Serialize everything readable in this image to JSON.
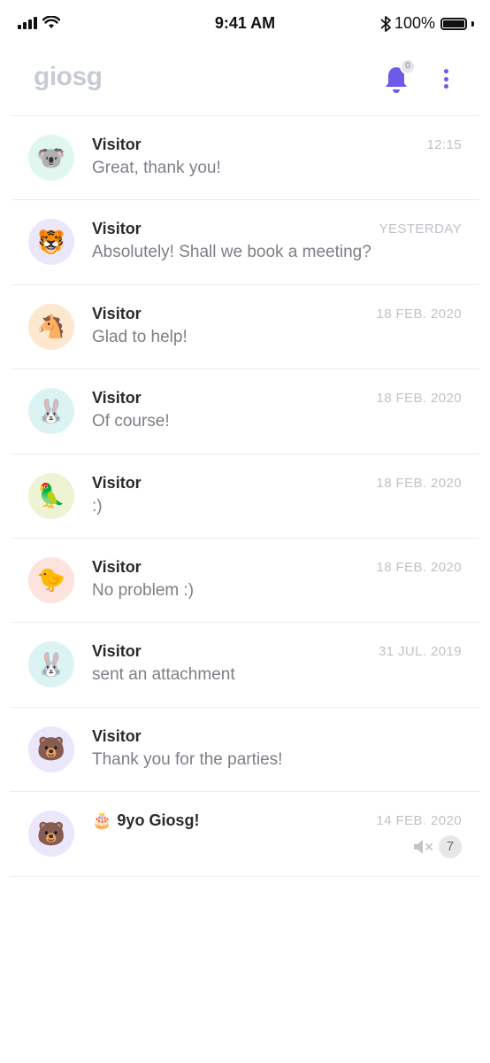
{
  "status_bar": {
    "time": "9:41 AM",
    "battery_text": "100%",
    "battery_level": 1.0
  },
  "header": {
    "logo": "giosg",
    "notification_badge": "0",
    "accent_color": "#6b5be6"
  },
  "conversations": [
    {
      "name": "Visitor",
      "preview": "Great, thank you!",
      "time": "12:15",
      "avatar_emoji": "🐨",
      "avatar_bg": "#dff7ee"
    },
    {
      "name": "Visitor",
      "preview": "Absolutely! Shall we book a meeting?",
      "time": "YESTERDAY",
      "avatar_emoji": "🐯",
      "avatar_bg": "#ece6fb"
    },
    {
      "name": "Visitor",
      "preview": "Glad to help!",
      "time": "18 FEB. 2020",
      "avatar_emoji": "🐴",
      "avatar_bg": "#fde8cf"
    },
    {
      "name": "Visitor",
      "preview": "Of course!",
      "time": "18 FEB. 2020",
      "avatar_emoji": "🐰",
      "avatar_bg": "#dcf3f4"
    },
    {
      "name": "Visitor",
      "preview": ":)",
      "time": "18 FEB. 2020",
      "avatar_emoji": "🦜",
      "avatar_bg": "#eef3d4"
    },
    {
      "name": "Visitor",
      "preview": "No problem :)",
      "time": "18 FEB. 2020",
      "avatar_emoji": "🐤",
      "avatar_bg": "#fde2de"
    },
    {
      "name": "Visitor",
      "preview": "sent an attachment",
      "time": "31 JUL. 2019",
      "avatar_emoji": "🐰",
      "avatar_bg": "#dcf3f4"
    },
    {
      "name": "Visitor",
      "preview": "Thank you for the parties!",
      "time": "",
      "avatar_emoji": "🐻",
      "avatar_bg": "#ece6fb"
    },
    {
      "name": "9yo Giosg!",
      "name_emoji": "🎂",
      "preview": "",
      "time": "14 FEB. 2020",
      "avatar_emoji": "🐻",
      "avatar_bg": "#ece6fb",
      "muted": true,
      "unread": "7"
    }
  ]
}
